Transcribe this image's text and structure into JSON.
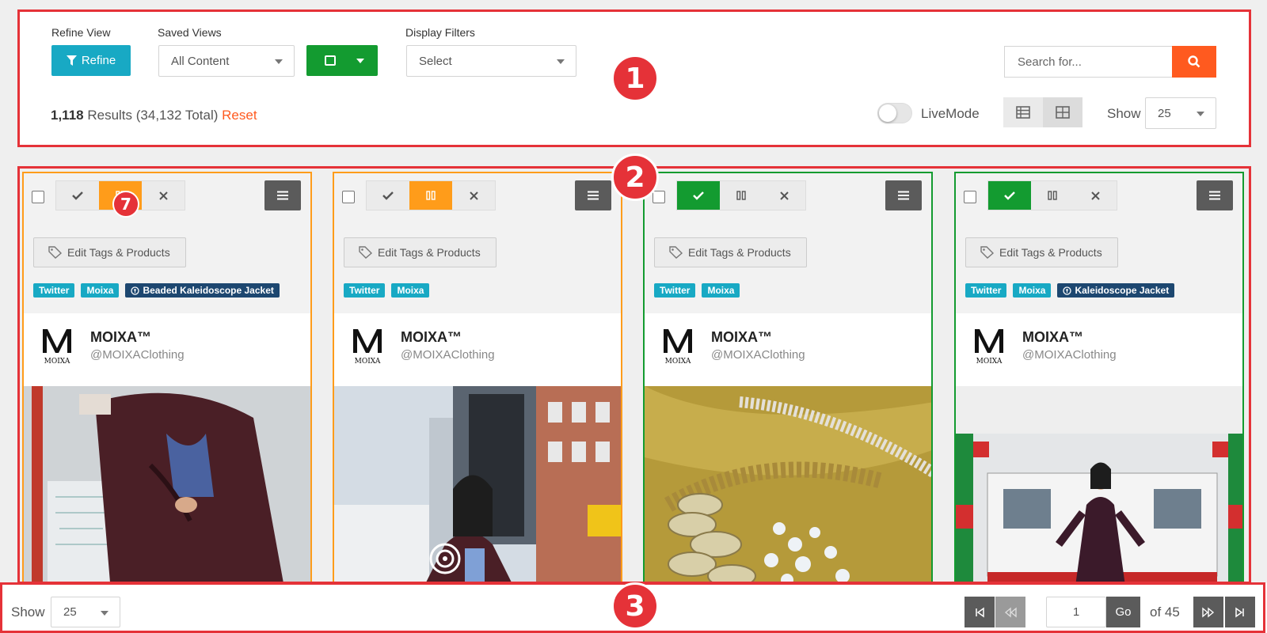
{
  "annotations": {
    "one": "1",
    "two": "2",
    "three": "3",
    "seven": "7"
  },
  "toolbar": {
    "refine_view_label": "Refine View",
    "refine_button": "Refine",
    "saved_views_label": "Saved Views",
    "saved_views_value": "All Content",
    "display_filters_label": "Display Filters",
    "display_filters_value": "Select",
    "search_placeholder": "Search for...",
    "results_count": "1,118",
    "results_text": "Results (34,132 Total)",
    "reset_label": "Reset",
    "livemode_label": "LiveMode",
    "livemode_on": false,
    "show_label": "Show",
    "show_value": "25"
  },
  "colors": {
    "accent_cyan": "#18a9c4",
    "accent_green": "#139b30",
    "accent_orange": "#ff9c1a",
    "search_orange": "#ff5a1f",
    "annotation_red": "#e53238",
    "tag_navy": "#1d4770"
  },
  "cards": [
    {
      "status": "paused",
      "edit_tags_label": "Edit Tags & Products",
      "tags": [
        "Twitter",
        "Moixa"
      ],
      "product_tag": "Beaded Kaleidoscope Jacket",
      "name": "MOIXA™",
      "handle": "@MOIXAClothing",
      "logo_text": "MOIXA",
      "photo_icon": "subway-woman-photo"
    },
    {
      "status": "paused",
      "edit_tags_label": "Edit Tags & Products",
      "tags": [
        "Twitter",
        "Moixa"
      ],
      "product_tag": "",
      "name": "MOIXA™",
      "handle": "@MOIXAClothing",
      "logo_text": "MOIXA",
      "photo_icon": "street-woman-photo"
    },
    {
      "status": "approved",
      "edit_tags_label": "Edit Tags & Products",
      "tags": [
        "Twitter",
        "Moixa"
      ],
      "product_tag": "",
      "name": "MOIXA™",
      "handle": "@MOIXAClothing",
      "logo_text": "MOIXA",
      "photo_icon": "sequins-photo"
    },
    {
      "status": "approved",
      "edit_tags_label": "Edit Tags & Products",
      "tags": [
        "Twitter",
        "Moixa"
      ],
      "product_tag": "Kaleidoscope Jacket",
      "name": "MOIXA™",
      "handle": "@MOIXAClothing",
      "logo_text": "MOIXA",
      "photo_icon": "station-woman-photo"
    }
  ],
  "pager": {
    "show_label": "Show",
    "show_value": "25",
    "page_value": "1",
    "go_label": "Go",
    "of_label": "of 45"
  }
}
